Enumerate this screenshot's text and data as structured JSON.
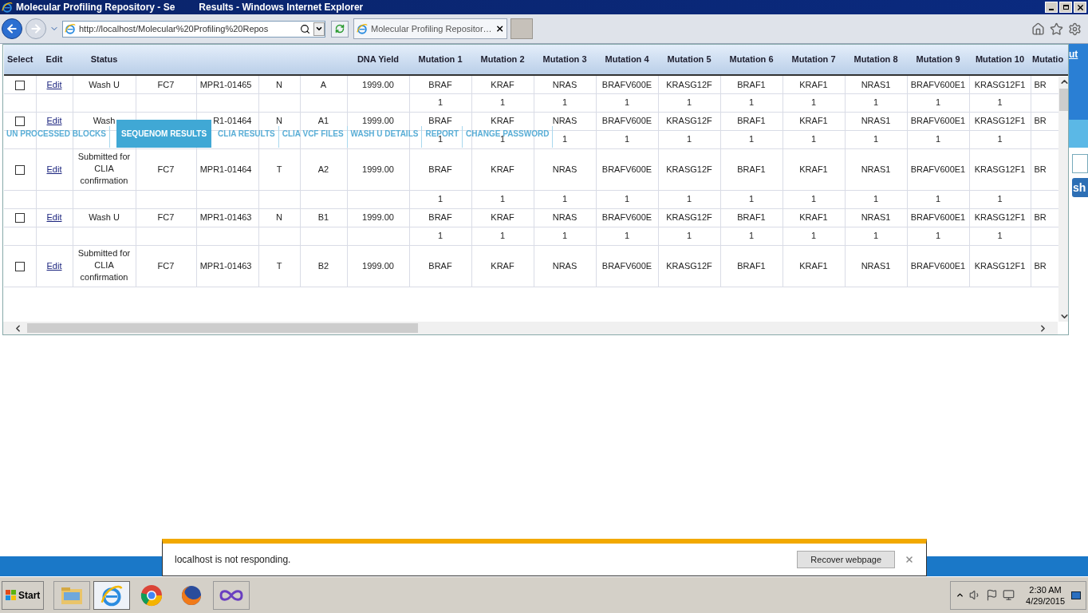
{
  "window": {
    "title": "Molecular Profiling Repository - Se         Results - Windows Internet Explorer"
  },
  "address_bar": {
    "value": "http://localhost/Molecular%20Profiling%20Repos"
  },
  "tab": {
    "label": "Molecular Profiling Repositor…",
    "selected": true
  },
  "nav": [
    {
      "label": "UN PROCESSED BLOCKS",
      "selected": false
    },
    {
      "label": "SEQUENOM RESULTS",
      "selected": true
    },
    {
      "label": "CLIA RESULTS",
      "selected": false
    },
    {
      "label": "CLIA VCF FILES",
      "selected": false
    },
    {
      "label": "WASH U DETAILS",
      "selected": false
    },
    {
      "label": "REPORT",
      "selected": false
    },
    {
      "label": "CHANGE PASSWORD",
      "selected": false
    }
  ],
  "side": {
    "link": "ut",
    "button": "sh"
  },
  "table": {
    "columns": [
      {
        "label": "Select"
      },
      {
        "label": "Edit"
      },
      {
        "label": "Status"
      },
      {},
      {},
      {},
      {},
      {
        "label": "DNA Yield"
      },
      {
        "label": "Mutation 1"
      },
      {
        "label": "Mutation 2"
      },
      {
        "label": "Mutation 3"
      },
      {
        "label": "Mutation 4"
      },
      {
        "label": "Mutation 5"
      },
      {
        "label": "Mutation 6"
      },
      {
        "label": "Mutation 7"
      },
      {
        "label": "Mutation 8"
      },
      {
        "label": "Mutation 9"
      },
      {
        "label": "Mutation 10"
      },
      {
        "label": "Mutatio"
      }
    ],
    "rows": [
      {
        "checked": false,
        "cells": [
          "",
          "Edit",
          "Wash U",
          "FC7",
          "MPR1-01465",
          "N",
          "A",
          "1999.00",
          "BRAF",
          "KRAF",
          "NRAS",
          "BRAFV600E",
          "KRASG12F",
          "BRAF1",
          "KRAF1",
          "NRAS1",
          "BRAFV600E1",
          "KRASG12F1",
          "BR"
        ],
        "sub_cells": [
          "",
          "",
          "",
          "",
          "",
          "",
          "",
          "",
          "1",
          "1",
          "1",
          "1",
          "1",
          "1",
          "1",
          "1",
          "1",
          "1",
          ""
        ]
      },
      {
        "checked": false,
        "cells": [
          "",
          "Edit",
          "Wash",
          "",
          "R1-01464",
          "N",
          "A1",
          "1999.00",
          "BRAF",
          "KRAF",
          "NRAS",
          "BRAFV600E",
          "KRASG12F",
          "BRAF1",
          "KRAF1",
          "NRAS1",
          "BRAFV600E1",
          "KRASG12F1",
          "BR"
        ],
        "sub_cells": [
          "",
          "",
          "",
          "",
          "",
          "",
          "",
          "",
          "1",
          "1",
          "1",
          "1",
          "1",
          "1",
          "1",
          "1",
          "1",
          "1",
          ""
        ]
      },
      {
        "checked": false,
        "cells": [
          "",
          "Edit",
          "Submitted for CLIA confirmation",
          "FC7",
          "MPR1-01464",
          "T",
          "A2",
          "1999.00",
          "BRAF",
          "KRAF",
          "NRAS",
          "BRAFV600E",
          "KRASG12F",
          "BRAF1",
          "KRAF1",
          "NRAS1",
          "BRAFV600E1",
          "KRASG12F1",
          "BR"
        ],
        "sub_cells": [
          "",
          "",
          "",
          "",
          "",
          "",
          "",
          "",
          "1",
          "1",
          "1",
          "1",
          "1",
          "1",
          "1",
          "1",
          "1",
          "1",
          ""
        ]
      },
      {
        "checked": false,
        "cells": [
          "",
          "Edit",
          "Wash U",
          "FC7",
          "MPR1-01463",
          "N",
          "B1",
          "1999.00",
          "BRAF",
          "KRAF",
          "NRAS",
          "BRAFV600E",
          "KRASG12F",
          "BRAF1",
          "KRAF1",
          "NRAS1",
          "BRAFV600E1",
          "KRASG12F1",
          "BR"
        ],
        "sub_cells": [
          "",
          "",
          "",
          "",
          "",
          "",
          "",
          "",
          "1",
          "1",
          "1",
          "1",
          "1",
          "1",
          "1",
          "1",
          "1",
          "1",
          ""
        ]
      },
      {
        "checked": false,
        "cells": [
          "",
          "Edit",
          "Submitted for CLIA confirmation",
          "FC7",
          "MPR1-01463",
          "T",
          "B2",
          "1999.00",
          "BRAF",
          "KRAF",
          "NRAS",
          "BRAFV600E",
          "KRASG12F",
          "BRAF1",
          "KRAF1",
          "NRAS1",
          "BRAFV600E1",
          "KRASG12F1",
          "BR"
        ]
      }
    ]
  },
  "notification": {
    "message": "localhost is not responding.",
    "button": "Recover webpage"
  },
  "taskbar": {
    "start": "Start",
    "clock": {
      "time": "2:30 AM",
      "date": "4/29/2015"
    }
  }
}
